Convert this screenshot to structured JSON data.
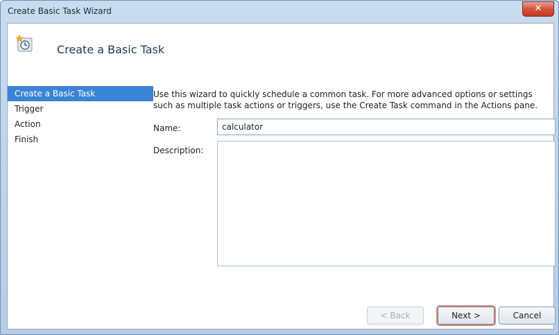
{
  "window": {
    "title": "Create Basic Task Wizard",
    "close_glyph": "✕"
  },
  "header": {
    "title": "Create a Basic Task",
    "icon": "task-scheduler-clock-icon"
  },
  "nav": {
    "items": [
      {
        "label": "Create a Basic Task",
        "active": true
      },
      {
        "label": "Trigger",
        "active": false
      },
      {
        "label": "Action",
        "active": false
      },
      {
        "label": "Finish",
        "active": false
      }
    ]
  },
  "main": {
    "intro_line1": "Use this wizard to quickly schedule a common task.  For more advanced options or settings",
    "intro_line2": "such as multiple task actions or triggers, use the Create Task command in the Actions pane.",
    "name_label": "Name:",
    "name_value": "calculator",
    "description_label": "Description:",
    "description_value": ""
  },
  "footer": {
    "back_label": "< Back",
    "next_label": "Next >",
    "cancel_label": "Cancel"
  },
  "colors": {
    "accent": "#3b83d6",
    "title_text": "#1e395b",
    "close_red": "#c33a22",
    "next_focus_outline": "#e08a68"
  }
}
